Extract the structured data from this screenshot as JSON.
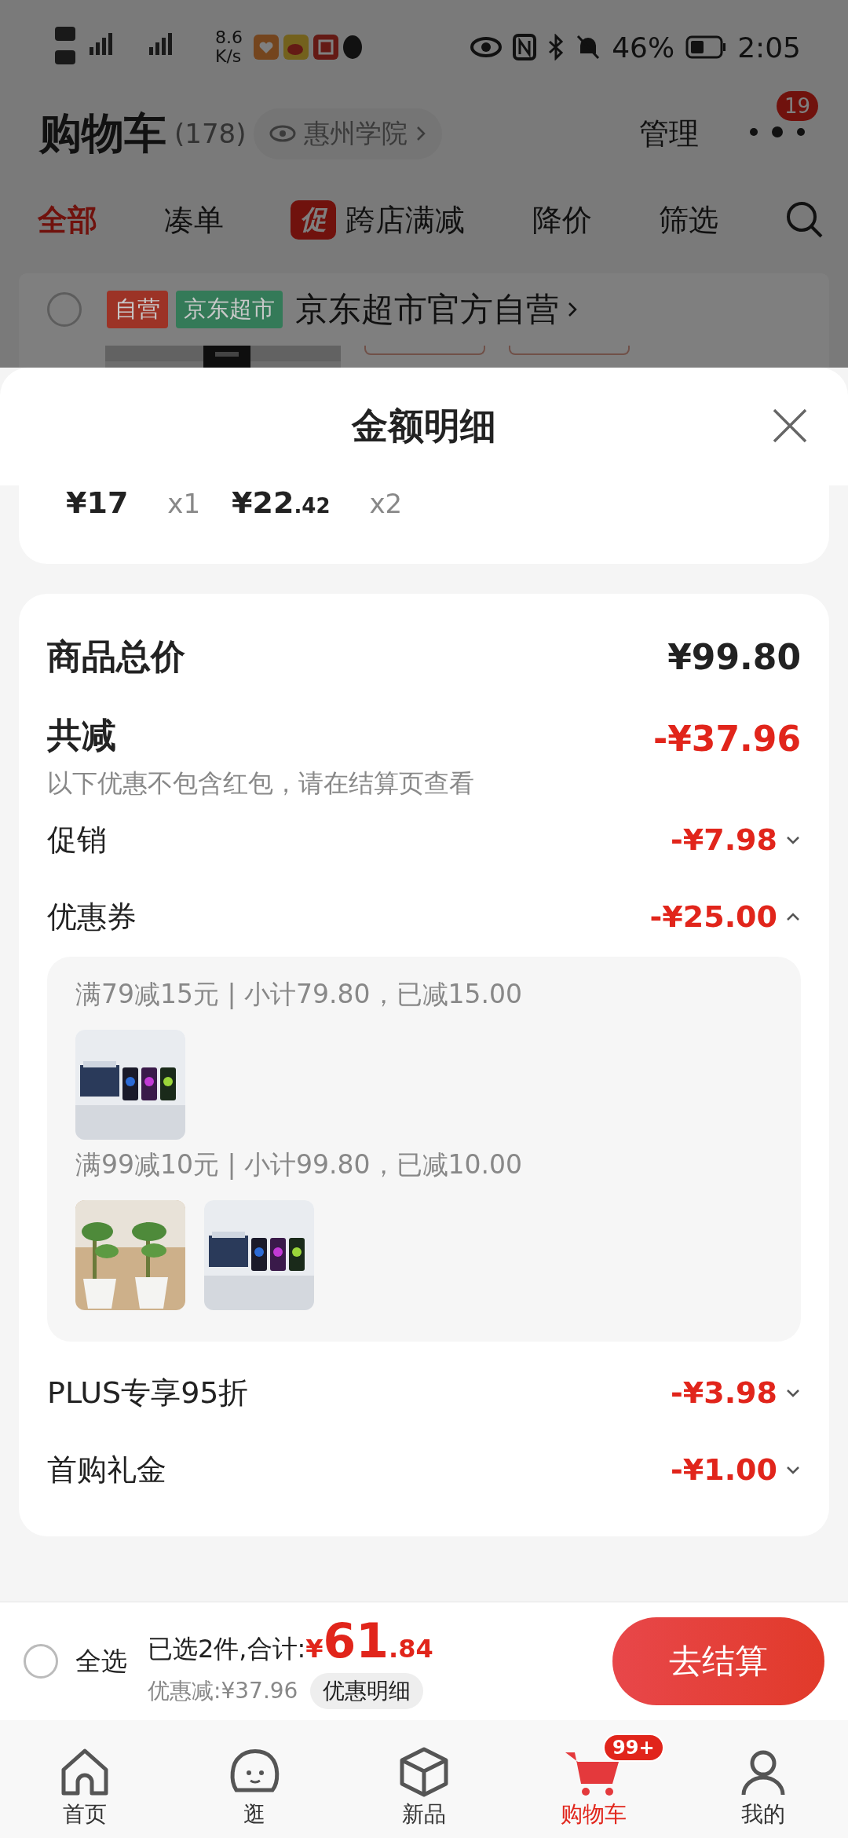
{
  "status_bar": {
    "speed": "8.6",
    "speed_unit": "K/s",
    "battery": "46%",
    "time": "2:05"
  },
  "header": {
    "title": "购物车",
    "count": "(178)",
    "location": "惠州学院",
    "manage": "管理",
    "badge": "19"
  },
  "tabs": [
    {
      "label": "全部",
      "selected": true
    },
    {
      "label": "凑单",
      "selected": false
    },
    {
      "label": "跨店满减",
      "selected": false,
      "tag": "促"
    },
    {
      "label": "降价",
      "selected": false
    },
    {
      "label": "筛选",
      "selected": false
    }
  ],
  "store": {
    "checked": false,
    "tags": [
      {
        "label": "自营",
        "color": "#9c3326"
      },
      {
        "label": "京东超市",
        "color": "#347a58"
      }
    ],
    "name": "京东超市官方自营"
  },
  "sheet": {
    "title": "金额明细",
    "items": [
      {
        "price": "¥17",
        "qty": "x1"
      },
      {
        "price": "¥22",
        "decimal": ".42",
        "qty": "x2"
      }
    ],
    "total_label": "商品总价",
    "total": "¥99.80",
    "reduce_label": "共减",
    "reduce": "-¥37.96",
    "note": "以下优惠不包含红包，请在结算页查看",
    "discounts": [
      {
        "label": "促销",
        "amount": "-¥7.98",
        "expanded": false
      },
      {
        "label": "优惠券",
        "amount": "-¥25.00",
        "expanded": true,
        "groups": [
          {
            "rule": "满79减15元 | 小计79.80，已减15.00"
          },
          {
            "rule": "满99减10元 | 小计99.80，已减10.00"
          }
        ]
      },
      {
        "label": "PLUS专享95折",
        "amount": "-¥3.98",
        "expanded": false
      },
      {
        "label": "首购礼金",
        "amount": "-¥1.00",
        "expanded": false
      }
    ]
  },
  "checkout_bar": {
    "select_all": {
      "label": "全选",
      "checked": false
    },
    "summary": "已选2件,合计:",
    "currency": "¥",
    "total": "61",
    "decimal": ".84",
    "saving": "优惠减:¥37.96",
    "detail_button": "优惠明细",
    "checkout_button": "去结算"
  },
  "nav": [
    {
      "label": "首页",
      "selected": false
    },
    {
      "label": "逛",
      "selected": false
    },
    {
      "label": "新品",
      "selected": false
    },
    {
      "label": "购物车",
      "selected": true,
      "badge": "99+"
    },
    {
      "label": "我的",
      "selected": false
    }
  ]
}
